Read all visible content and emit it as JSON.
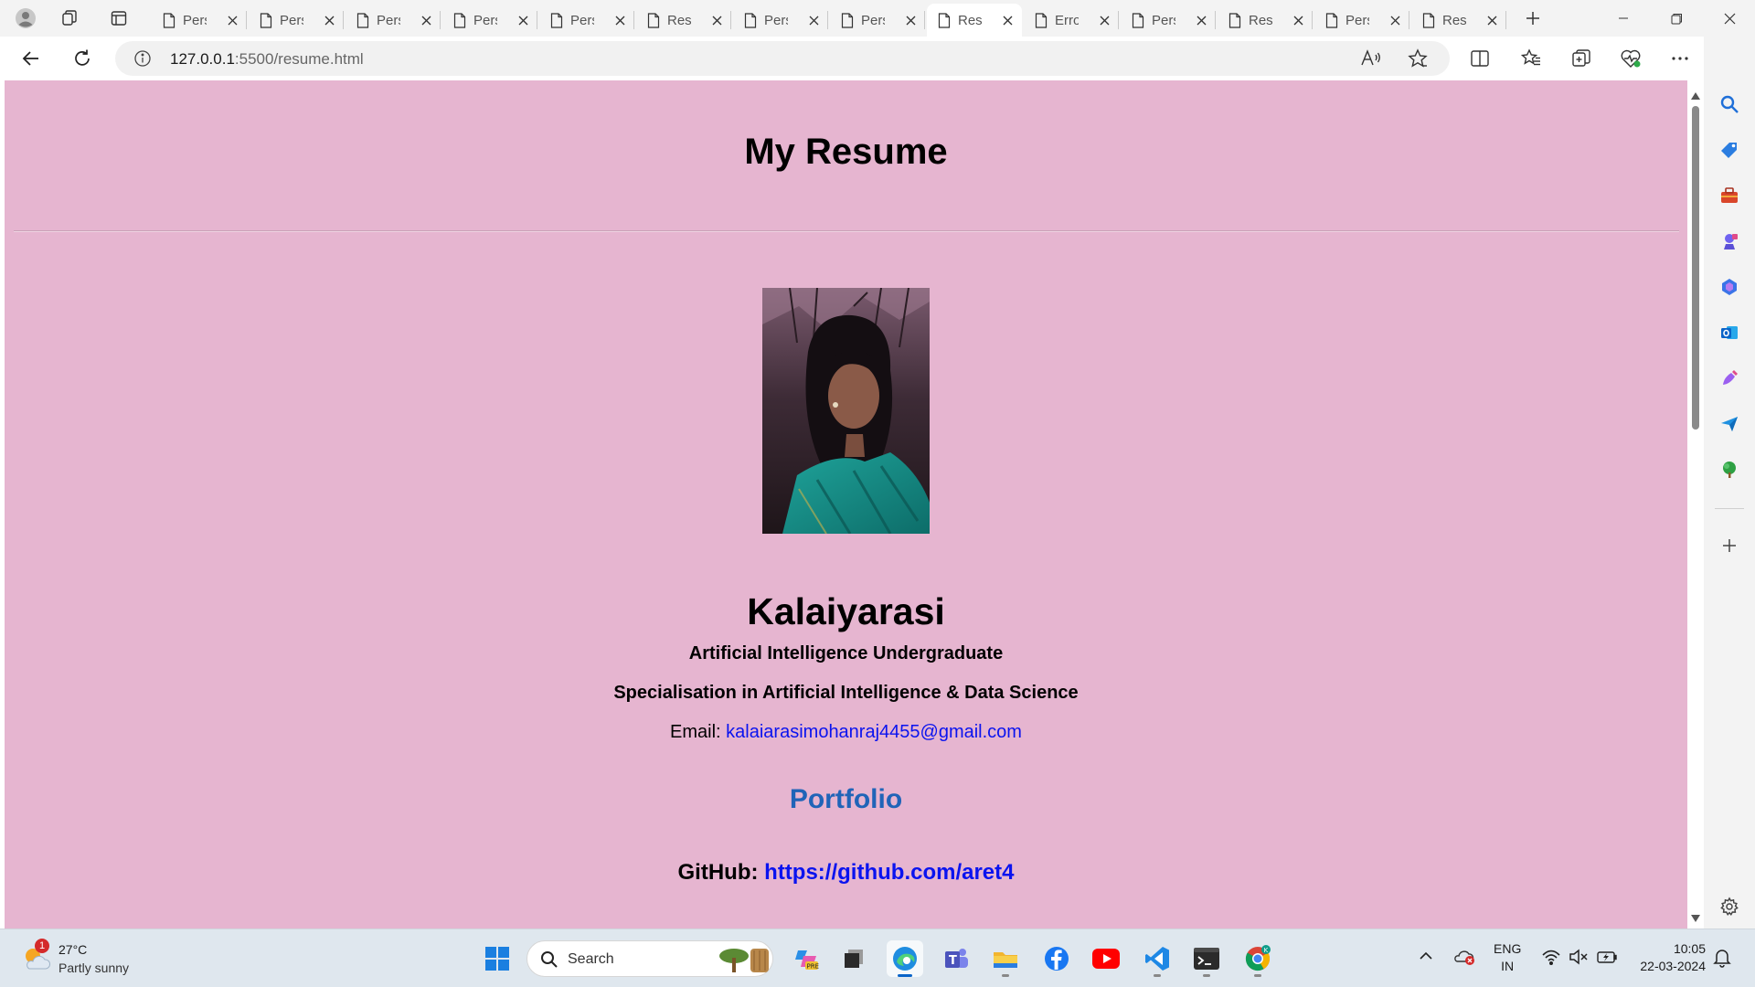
{
  "browser": {
    "tabs": [
      {
        "title": "Pers",
        "active": false
      },
      {
        "title": "Pers",
        "active": false
      },
      {
        "title": "Pers",
        "active": false
      },
      {
        "title": "Pers",
        "active": false
      },
      {
        "title": "Pers",
        "active": false
      },
      {
        "title": "Resu",
        "active": false
      },
      {
        "title": "Pers",
        "active": false
      },
      {
        "title": "Pers",
        "active": false
      },
      {
        "title": "Resu",
        "active": true
      },
      {
        "title": "Erro",
        "active": false
      },
      {
        "title": "Pers",
        "active": false
      },
      {
        "title": "Resu",
        "active": false
      },
      {
        "title": "Pers",
        "active": false
      },
      {
        "title": "Resu",
        "active": false
      }
    ],
    "url_host": "127.0.0.1",
    "url_path": ":5500/resume.html"
  },
  "page": {
    "heading": "My Resume",
    "name": "Kalaiyarasi",
    "role": "Artificial Intelligence Undergraduate",
    "specialisation": "Specialisation in Artificial Intelligence & Data Science",
    "email_label": "Email:",
    "email": "kalaiarasimohanraj4455@gmail.com",
    "portfolio_heading": "Portfolio",
    "github_label": "GitHub:",
    "github_url": "https://github.com/aret4"
  },
  "taskbar": {
    "weather_badge": "1",
    "weather_temp": "27°C",
    "weather_desc": "Partly sunny",
    "search_label": "Search",
    "lang_top": "ENG",
    "lang_bottom": "IN",
    "time": "10:05",
    "date": "22-03-2024",
    "pinned_apps": [
      "widgets-game",
      "copilot-pre",
      "file-manager",
      "edge",
      "teams",
      "file-explorer",
      "facebook",
      "youtube",
      "vscode",
      "terminal",
      "chrome"
    ]
  },
  "colors": {
    "page_background": "#e6b5d0",
    "link": "#0a13ef",
    "portfolio_heading": "#2064b8",
    "accent": "#0a64c8"
  }
}
